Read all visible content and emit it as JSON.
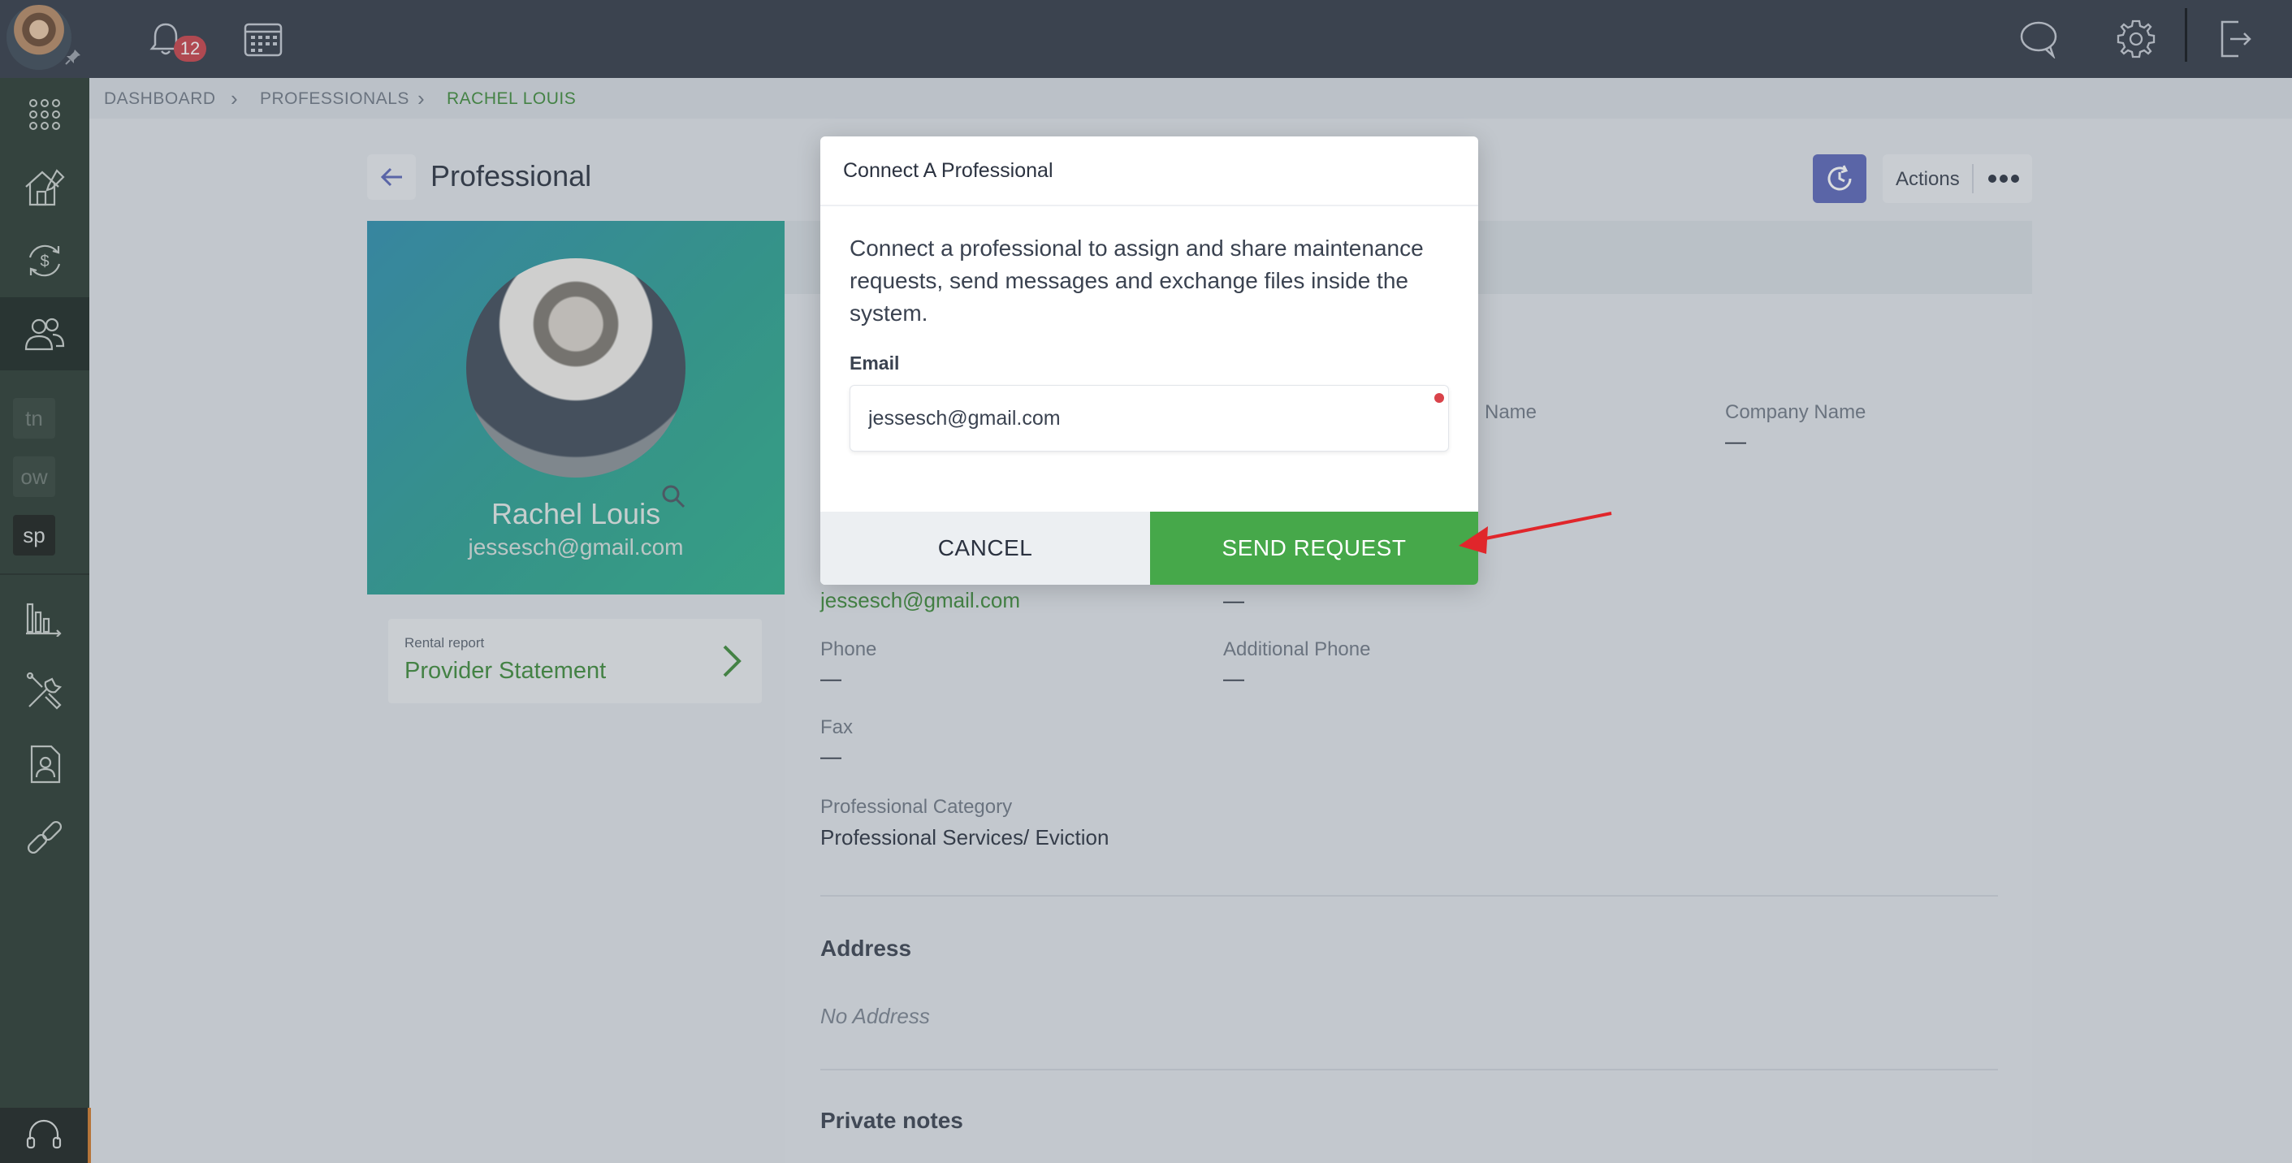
{
  "topbar": {
    "notifications_count": "12",
    "icons": [
      "bell-icon",
      "calendar-icon",
      "chat-icon",
      "gear-icon",
      "logout-icon"
    ]
  },
  "sidebar": {
    "items": [
      "apps-grid-icon",
      "property-icon",
      "money-cycle-icon",
      "people-icon",
      "reports-icon",
      "tools-icon",
      "contact-icon",
      "link-icon"
    ],
    "tags": [
      "tn",
      "ow",
      "sp"
    ],
    "support_icon": "headset-icon"
  },
  "breadcrumb": {
    "items": [
      "DASHBOARD",
      "PROFESSIONALS",
      "RACHEL LOUIS"
    ]
  },
  "header": {
    "title": "Professional",
    "actions_label": "Actions"
  },
  "profile": {
    "name": "Rachel Louis",
    "email": "jessesch@gmail.com"
  },
  "report": {
    "label": "Rental report",
    "title": "Provider Statement"
  },
  "details": {
    "name_label_fragment": "Name",
    "company_label": "Company Name",
    "company_value": "—",
    "email_value": "jessesch@gmail.com",
    "email_side_value": "—",
    "phone_label": "Phone",
    "phone_value": "—",
    "additional_phone_label": "Additional Phone",
    "additional_phone_value": "—",
    "fax_label": "Fax",
    "fax_value": "—",
    "category_label": "Professional Category",
    "category_value": "Professional Services/ Eviction",
    "address_title": "Address",
    "no_address": "No Address",
    "private_notes_title": "Private notes"
  },
  "modal": {
    "title": "Connect A Professional",
    "description": "Connect a professional to assign and share maintenance requests, send messages and exchange files inside the system.",
    "email_label": "Email",
    "email_value": "jessesch@gmail.com",
    "cancel_label": "CANCEL",
    "send_label": "SEND REQUEST"
  },
  "colors": {
    "accent_green": "#46a84a",
    "link_green": "#3e8b3a",
    "refresh_blue": "#5a66b8",
    "badge_red": "#c8424a",
    "annotation_red": "#e0262b"
  }
}
